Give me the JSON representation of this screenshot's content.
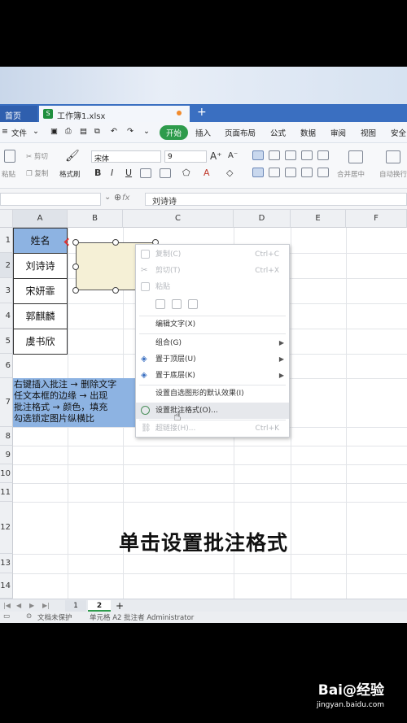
{
  "tabs": {
    "home": "首页",
    "file": "工作簿1.xlsx"
  },
  "menu": {
    "file": "文件",
    "items": [
      "开始",
      "插入",
      "页面布局",
      "公式",
      "数据",
      "审阅",
      "视图",
      "安全"
    ]
  },
  "ribbon": {
    "paste": "粘贴",
    "cut": "剪切",
    "copy": "复制",
    "format_painter": "格式刷",
    "font_name": "宋体",
    "font_size": "9",
    "merge": "合并居中",
    "wrap": "自动换行"
  },
  "formula_bar": {
    "fx": "fx",
    "value": "刘诗诗"
  },
  "columns": [
    "A",
    "B",
    "C",
    "D",
    "E",
    "F"
  ],
  "rows": [
    "1",
    "2",
    "3",
    "4",
    "5",
    "6",
    "7",
    "8",
    "9",
    "10",
    "11",
    "12",
    "13",
    "14"
  ],
  "cells": [
    "姓名",
    "刘诗诗",
    "宋妍霏",
    "郭麒麟",
    "虞书欣"
  ],
  "note_lines": [
    "右键插入批注  →  删除文字",
    "任文本框的边缘  →  出现",
    "批注格式  →  颜色，填充",
    "勾选锁定图片纵横比"
  ],
  "context_menu": [
    {
      "label": "复制(C)",
      "shortcut": "Ctrl+C",
      "disabled": true
    },
    {
      "label": "剪切(T)",
      "shortcut": "Ctrl+X",
      "disabled": true
    },
    {
      "label": "粘贴",
      "shortcut": "",
      "disabled": true
    },
    {
      "label": "编辑文字(X)",
      "shortcut": "",
      "disabled": false
    },
    {
      "label": "组合(G)",
      "shortcut": "",
      "disabled": false
    },
    {
      "label": "置于顶层(U)",
      "shortcut": "",
      "disabled": false
    },
    {
      "label": "置于底层(K)",
      "shortcut": "",
      "disabled": false
    },
    {
      "label": "设置自选图形的默认效果(I)",
      "shortcut": "",
      "disabled": false
    },
    {
      "label": "设置批注格式(O)...",
      "shortcut": "",
      "disabled": false
    },
    {
      "label": "超链接(H)...",
      "shortcut": "Ctrl+K",
      "disabled": true
    }
  ],
  "caption": "单击设置批注格式",
  "sheet_tabs": [
    "1",
    "2",
    "+"
  ],
  "status": {
    "doc": "文档未保护",
    "cell_info": "单元格 A2 批注者 Administrator"
  },
  "watermark": {
    "brand": "Bai@经验",
    "url": "jingyan.baidu.com"
  }
}
